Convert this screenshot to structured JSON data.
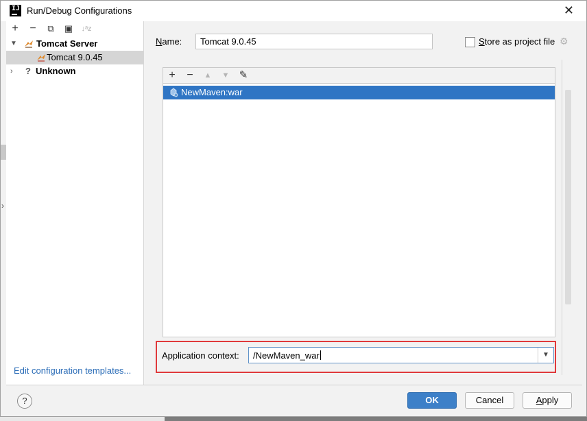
{
  "window": {
    "title": "Run/Debug Configurations",
    "app_icon_text": "IJ"
  },
  "left_toolbar": {
    "add": "+",
    "remove": "−",
    "copy": "⧉",
    "folder": "▣",
    "sort": "↓ᵃz"
  },
  "tree": [
    {
      "label": "Tomcat Server",
      "expanded": true
    },
    {
      "label": "Tomcat 9.0.45",
      "selected": true
    },
    {
      "label": "Unknown",
      "expanded": false
    }
  ],
  "edit_templates_link": "Edit configuration templates...",
  "name_field": {
    "label_prefix": "N",
    "label_rest": "ame:",
    "value": "Tomcat 9.0.45"
  },
  "store_checkbox": {
    "label_prefix": "S",
    "label_rest": "tore as project file",
    "checked": false
  },
  "list_toolbar": {
    "add": "+",
    "remove": "−",
    "up": "▲",
    "down": "▼",
    "edit": "✎"
  },
  "deployment_list": [
    {
      "label": "NewMaven:war",
      "selected": true
    }
  ],
  "app_context": {
    "label": "Application context:",
    "value": "/NewMaven_war"
  },
  "buttons": {
    "help": "?",
    "ok": "OK",
    "cancel": "Cancel",
    "apply_prefix": "A",
    "apply_rest": "pply"
  },
  "colors": {
    "selection": "#2f75c4",
    "highlight_border": "#e0393b",
    "primary_button": "#3d80c8",
    "link": "#2a6cb7"
  }
}
